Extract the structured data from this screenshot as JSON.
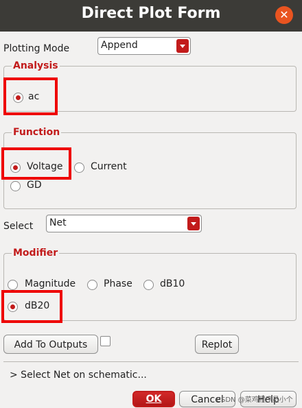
{
  "window": {
    "title": "Direct Plot Form"
  },
  "plotting_mode": {
    "label": "Plotting Mode",
    "value": "Append"
  },
  "analysis": {
    "title": "Analysis",
    "options": [
      {
        "label": "ac",
        "checked": true
      }
    ]
  },
  "function": {
    "title": "Function",
    "options": [
      {
        "label": "Voltage",
        "checked": true
      },
      {
        "label": "Current",
        "checked": false
      },
      {
        "label": "GD",
        "checked": false
      }
    ]
  },
  "select": {
    "label": "Select",
    "value": "Net"
  },
  "modifier": {
    "title": "Modifier",
    "options": [
      {
        "label": "Magnitude",
        "checked": false
      },
      {
        "label": "Phase",
        "checked": false
      },
      {
        "label": "dB10",
        "checked": false
      },
      {
        "label": "dB20",
        "checked": true
      }
    ]
  },
  "actions": {
    "add_to_outputs": "Add To Outputs",
    "replot": "Replot"
  },
  "status": {
    "text": "> Select Net on schematic..."
  },
  "footer": {
    "ok": "OK",
    "cancel": "Cancel",
    "help": "Help"
  },
  "watermark": "CSDN @菜鸡程序员小个",
  "colors": {
    "accent": "#c21b1b",
    "highlight": "#ee0000",
    "titlebar": "#3c3b37"
  }
}
